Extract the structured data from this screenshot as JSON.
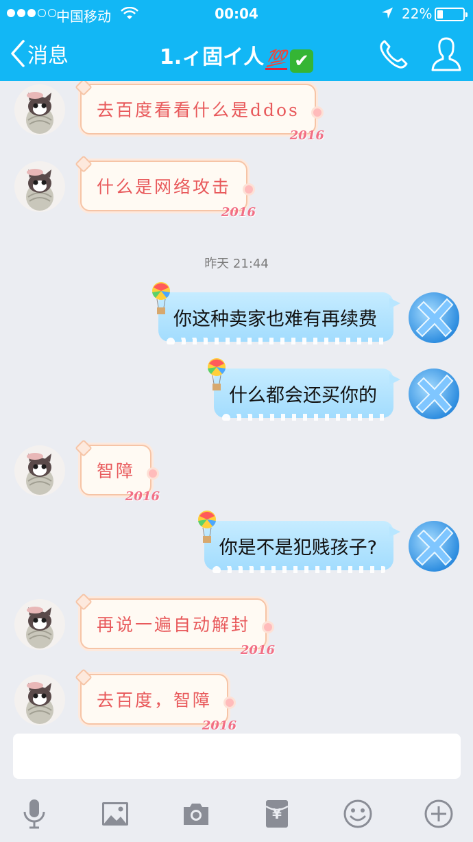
{
  "status_bar": {
    "carrier": "中国移动",
    "time": "00:04",
    "battery_percent": "22%",
    "battery_level": 0.22
  },
  "nav": {
    "back_label": "消息",
    "title": "1.ィ固イ人",
    "title_emoji_100": "💯",
    "title_emoji_check": "✔"
  },
  "messages": [
    {
      "side": "left",
      "text": "去百度看看什么是ddos",
      "sticker": "2016"
    },
    {
      "side": "left",
      "text": "什么是网络攻击",
      "sticker": "2016"
    },
    {
      "side": "time",
      "text": "昨天 21:44"
    },
    {
      "side": "right",
      "text": "你这种卖家也难有再续费"
    },
    {
      "side": "right",
      "text": "什么都会还买你的"
    },
    {
      "side": "left",
      "text": "智障",
      "sticker": "2016"
    },
    {
      "side": "right",
      "text": "你是不是犯贱孩子?"
    },
    {
      "side": "left",
      "text": "再说一遍自动解封",
      "sticker": "2016"
    },
    {
      "side": "left",
      "text": "去百度，智障",
      "sticker": "2016"
    }
  ],
  "composer": {
    "input_value": "",
    "tools": [
      "microphone-icon",
      "image-icon",
      "camera-icon",
      "red-packet-icon",
      "emoji-icon",
      "plus-icon"
    ],
    "red_packet_symbol": "¥"
  },
  "colors": {
    "nav_bg": "#12b7f5",
    "bubble_left_text": "#e8595b",
    "bubble_right_bg": "#b3e3ff",
    "tool_icon": "#8a8d96"
  }
}
